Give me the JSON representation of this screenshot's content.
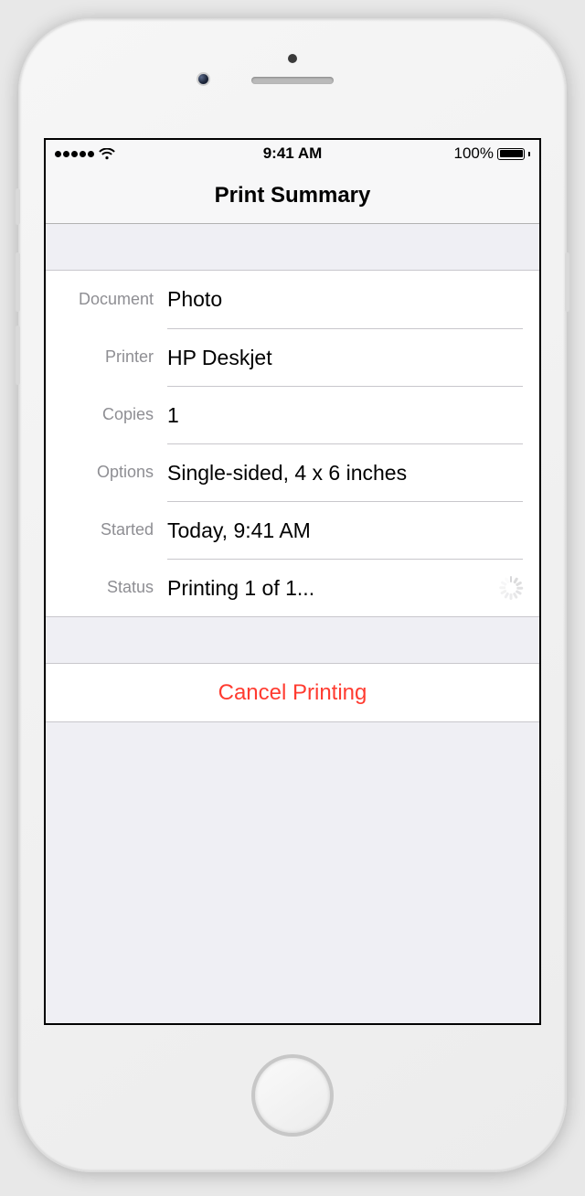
{
  "status_bar": {
    "time": "9:41 AM",
    "battery_percent": "100%"
  },
  "nav": {
    "title": "Print Summary"
  },
  "rows": {
    "document": {
      "label": "Document",
      "value": "Photo"
    },
    "printer": {
      "label": "Printer",
      "value": "HP Deskjet"
    },
    "copies": {
      "label": "Copies",
      "value": "1"
    },
    "options": {
      "label": "Options",
      "value": "Single-sided, 4 x 6 inches"
    },
    "started": {
      "label": "Started",
      "value": "Today, 9:41 AM"
    },
    "status": {
      "label": "Status",
      "value": "Printing 1 of 1..."
    }
  },
  "actions": {
    "cancel": "Cancel Printing"
  }
}
